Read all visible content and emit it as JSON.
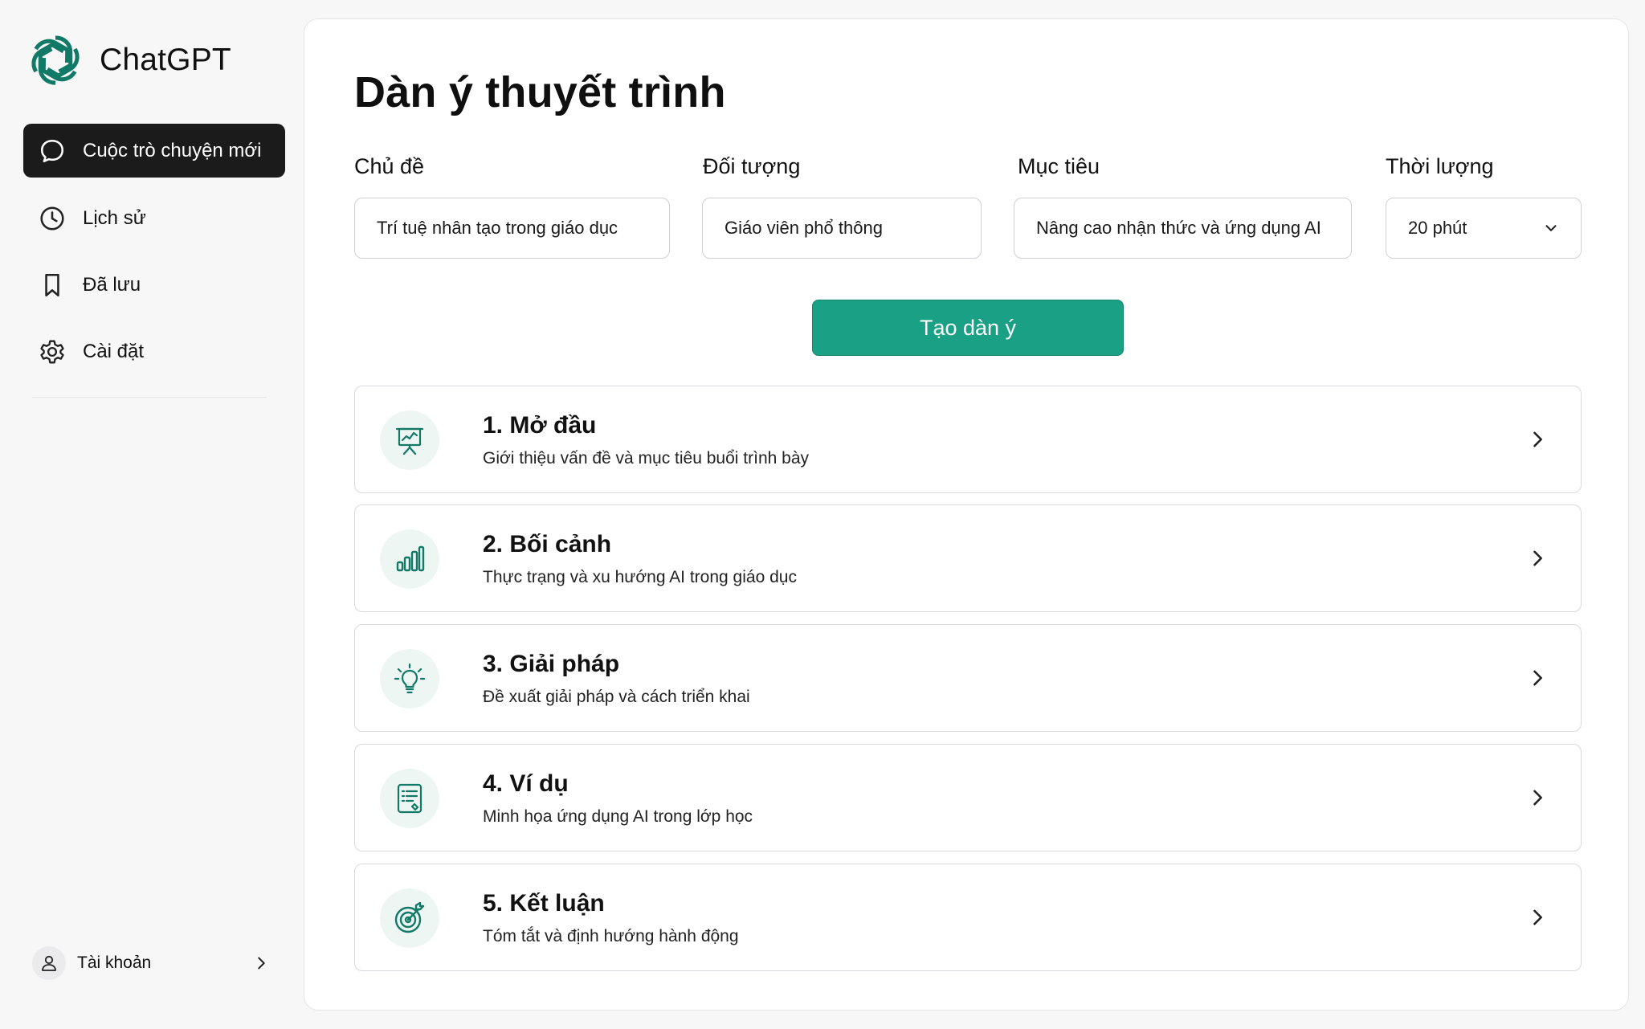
{
  "colors": {
    "accent": "#1aa085",
    "accent_dark": "#117a66",
    "sidebar_active": "#1b1b1c",
    "icon_bg": "#eef6f4"
  },
  "brand": {
    "name": "ChatGPT",
    "icon": "openai-logo"
  },
  "sidebar": {
    "items": [
      {
        "label": "Cuộc trò chuyện mới",
        "icon": "chat-bubble-icon",
        "active": true
      },
      {
        "label": "Lịch sử",
        "icon": "clock-icon",
        "active": false
      },
      {
        "label": "Đã lưu",
        "icon": "bookmark-icon",
        "active": false
      },
      {
        "label": "Cài đặt",
        "icon": "gear-icon",
        "active": false
      }
    ],
    "account": {
      "label": "Tài khoản",
      "icon": "user-icon"
    }
  },
  "main": {
    "title": "Dàn ý thuyết trình",
    "fields": [
      {
        "label": "Chủ đề",
        "value": "Trí tuệ nhân tạo trong giáo dục"
      },
      {
        "label": "Đối tượng",
        "value": "Giáo viên phổ thông"
      },
      {
        "label": "Mục tiêu",
        "value": "Nâng cao nhận thức và ứng dụng AI"
      },
      {
        "label": "Thời lượng",
        "value": "20 phút",
        "type": "select"
      }
    ],
    "generate_label": "Tạo dàn ý",
    "outline": [
      {
        "title": "1. Mở đầu",
        "desc": "Giới thiệu vấn đề và mục tiêu buổi trình bày",
        "icon": "presentation-board-icon"
      },
      {
        "title": "2. Bối cảnh",
        "desc": "Thực trạng và xu hướng AI trong giáo dục",
        "icon": "bar-chart-icon"
      },
      {
        "title": "3. Giải pháp",
        "desc": "Đề xuất giải pháp và cách triển khai",
        "icon": "lightbulb-icon"
      },
      {
        "title": "4. Ví dụ",
        "desc": "Minh họa ứng dụng AI trong lớp học",
        "icon": "document-icon"
      },
      {
        "title": "5. Kết luận",
        "desc": "Tóm tắt và định hướng hành động",
        "icon": "target-icon"
      }
    ]
  }
}
